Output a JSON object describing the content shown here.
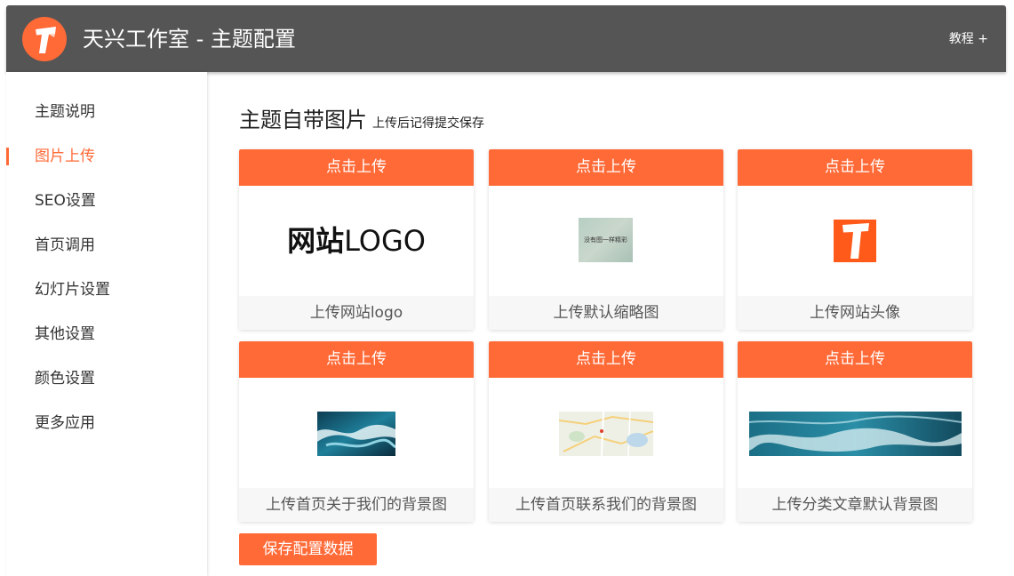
{
  "header": {
    "title": "天兴工作室 - 主题配置",
    "menu_label": "教程 +",
    "logo_icon": "orange-circle-T-logo"
  },
  "sidebar": {
    "items": [
      {
        "label": "主题说明",
        "active": false
      },
      {
        "label": "图片上传",
        "active": true
      },
      {
        "label": "SEO设置",
        "active": false
      },
      {
        "label": "首页调用",
        "active": false
      },
      {
        "label": "幻灯片设置",
        "active": false
      },
      {
        "label": "其他设置",
        "active": false
      },
      {
        "label": "颜色设置",
        "active": false
      },
      {
        "label": "更多应用",
        "active": false
      }
    ]
  },
  "main": {
    "title": "主题自带图片",
    "subtitle": "上传后记得提交保存",
    "cards": [
      {
        "button": "点击上传",
        "label": "上传网站logo",
        "preview": {
          "bold": "网站",
          "normal": "LOGO"
        }
      },
      {
        "button": "点击上传",
        "label": "上传默认缩略图",
        "preview": {
          "caption": "没有图一样精彩"
        }
      },
      {
        "button": "点击上传",
        "label": "上传网站头像"
      },
      {
        "button": "点击上传",
        "label": "上传首页关于我们的背景图"
      },
      {
        "button": "点击上传",
        "label": "上传首页联系我们的背景图"
      },
      {
        "button": "点击上传",
        "label": "上传分类文章默认背景图"
      }
    ],
    "save_label": "保存配置数据"
  },
  "colors": {
    "accent": "#ff6a37",
    "header_bg": "#555555",
    "label_bg": "#f7f7f7"
  }
}
